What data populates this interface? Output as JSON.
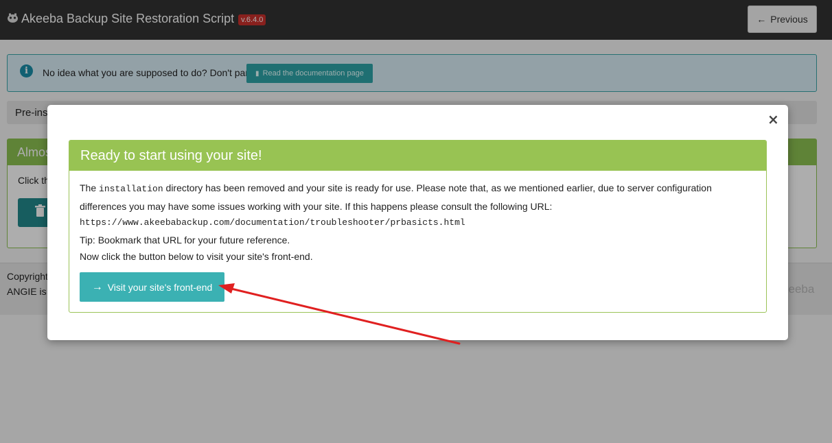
{
  "header": {
    "title": "Akeeba Backup Site Restoration Script",
    "version": "v.6.4.0",
    "previous_label": "Previous"
  },
  "info_alert": {
    "text": "No idea what you are supposed to do? Don't panic!",
    "doc_button_label": "Read the documentation page"
  },
  "preinstall": {
    "text": "Pre-ins"
  },
  "almost": {
    "title": "Almos",
    "body_text": "Click th"
  },
  "footer": {
    "line1": "Copyright",
    "line2": "ANGIE is",
    "logo_text": "keeba"
  },
  "modal": {
    "title": "Ready to start using your site!",
    "text_before_code": "The ",
    "code_word": "installation",
    "text_after_code": " directory has been removed and your site is ready for use. Please note that, as we mentioned earlier, due to server configuration differences you may have some issues working with your site. If this happens please consult the following URL:",
    "url": "https://www.akeebabackup.com/documentation/troubleshooter/prbasicts.html",
    "tip": "Tip: Bookmark that URL for your future reference.",
    "instruction": "Now click the button below to visit your site's front-end.",
    "visit_button_label": "Visit your site's front-end",
    "close_symbol": "×"
  },
  "icons": {
    "brand": "akeeba-logo-icon",
    "previous": "arrow-left-icon",
    "info": "info-circle-icon",
    "doc": "book-icon",
    "trash": "trash-icon",
    "visit": "arrow-right-icon",
    "close": "close-icon"
  },
  "colors": {
    "topbar": "#333333",
    "version_badge": "#c9302c",
    "success_green": "#98c353",
    "teal_button": "#3bb1b3",
    "annotation_arrow": "#e02020"
  }
}
